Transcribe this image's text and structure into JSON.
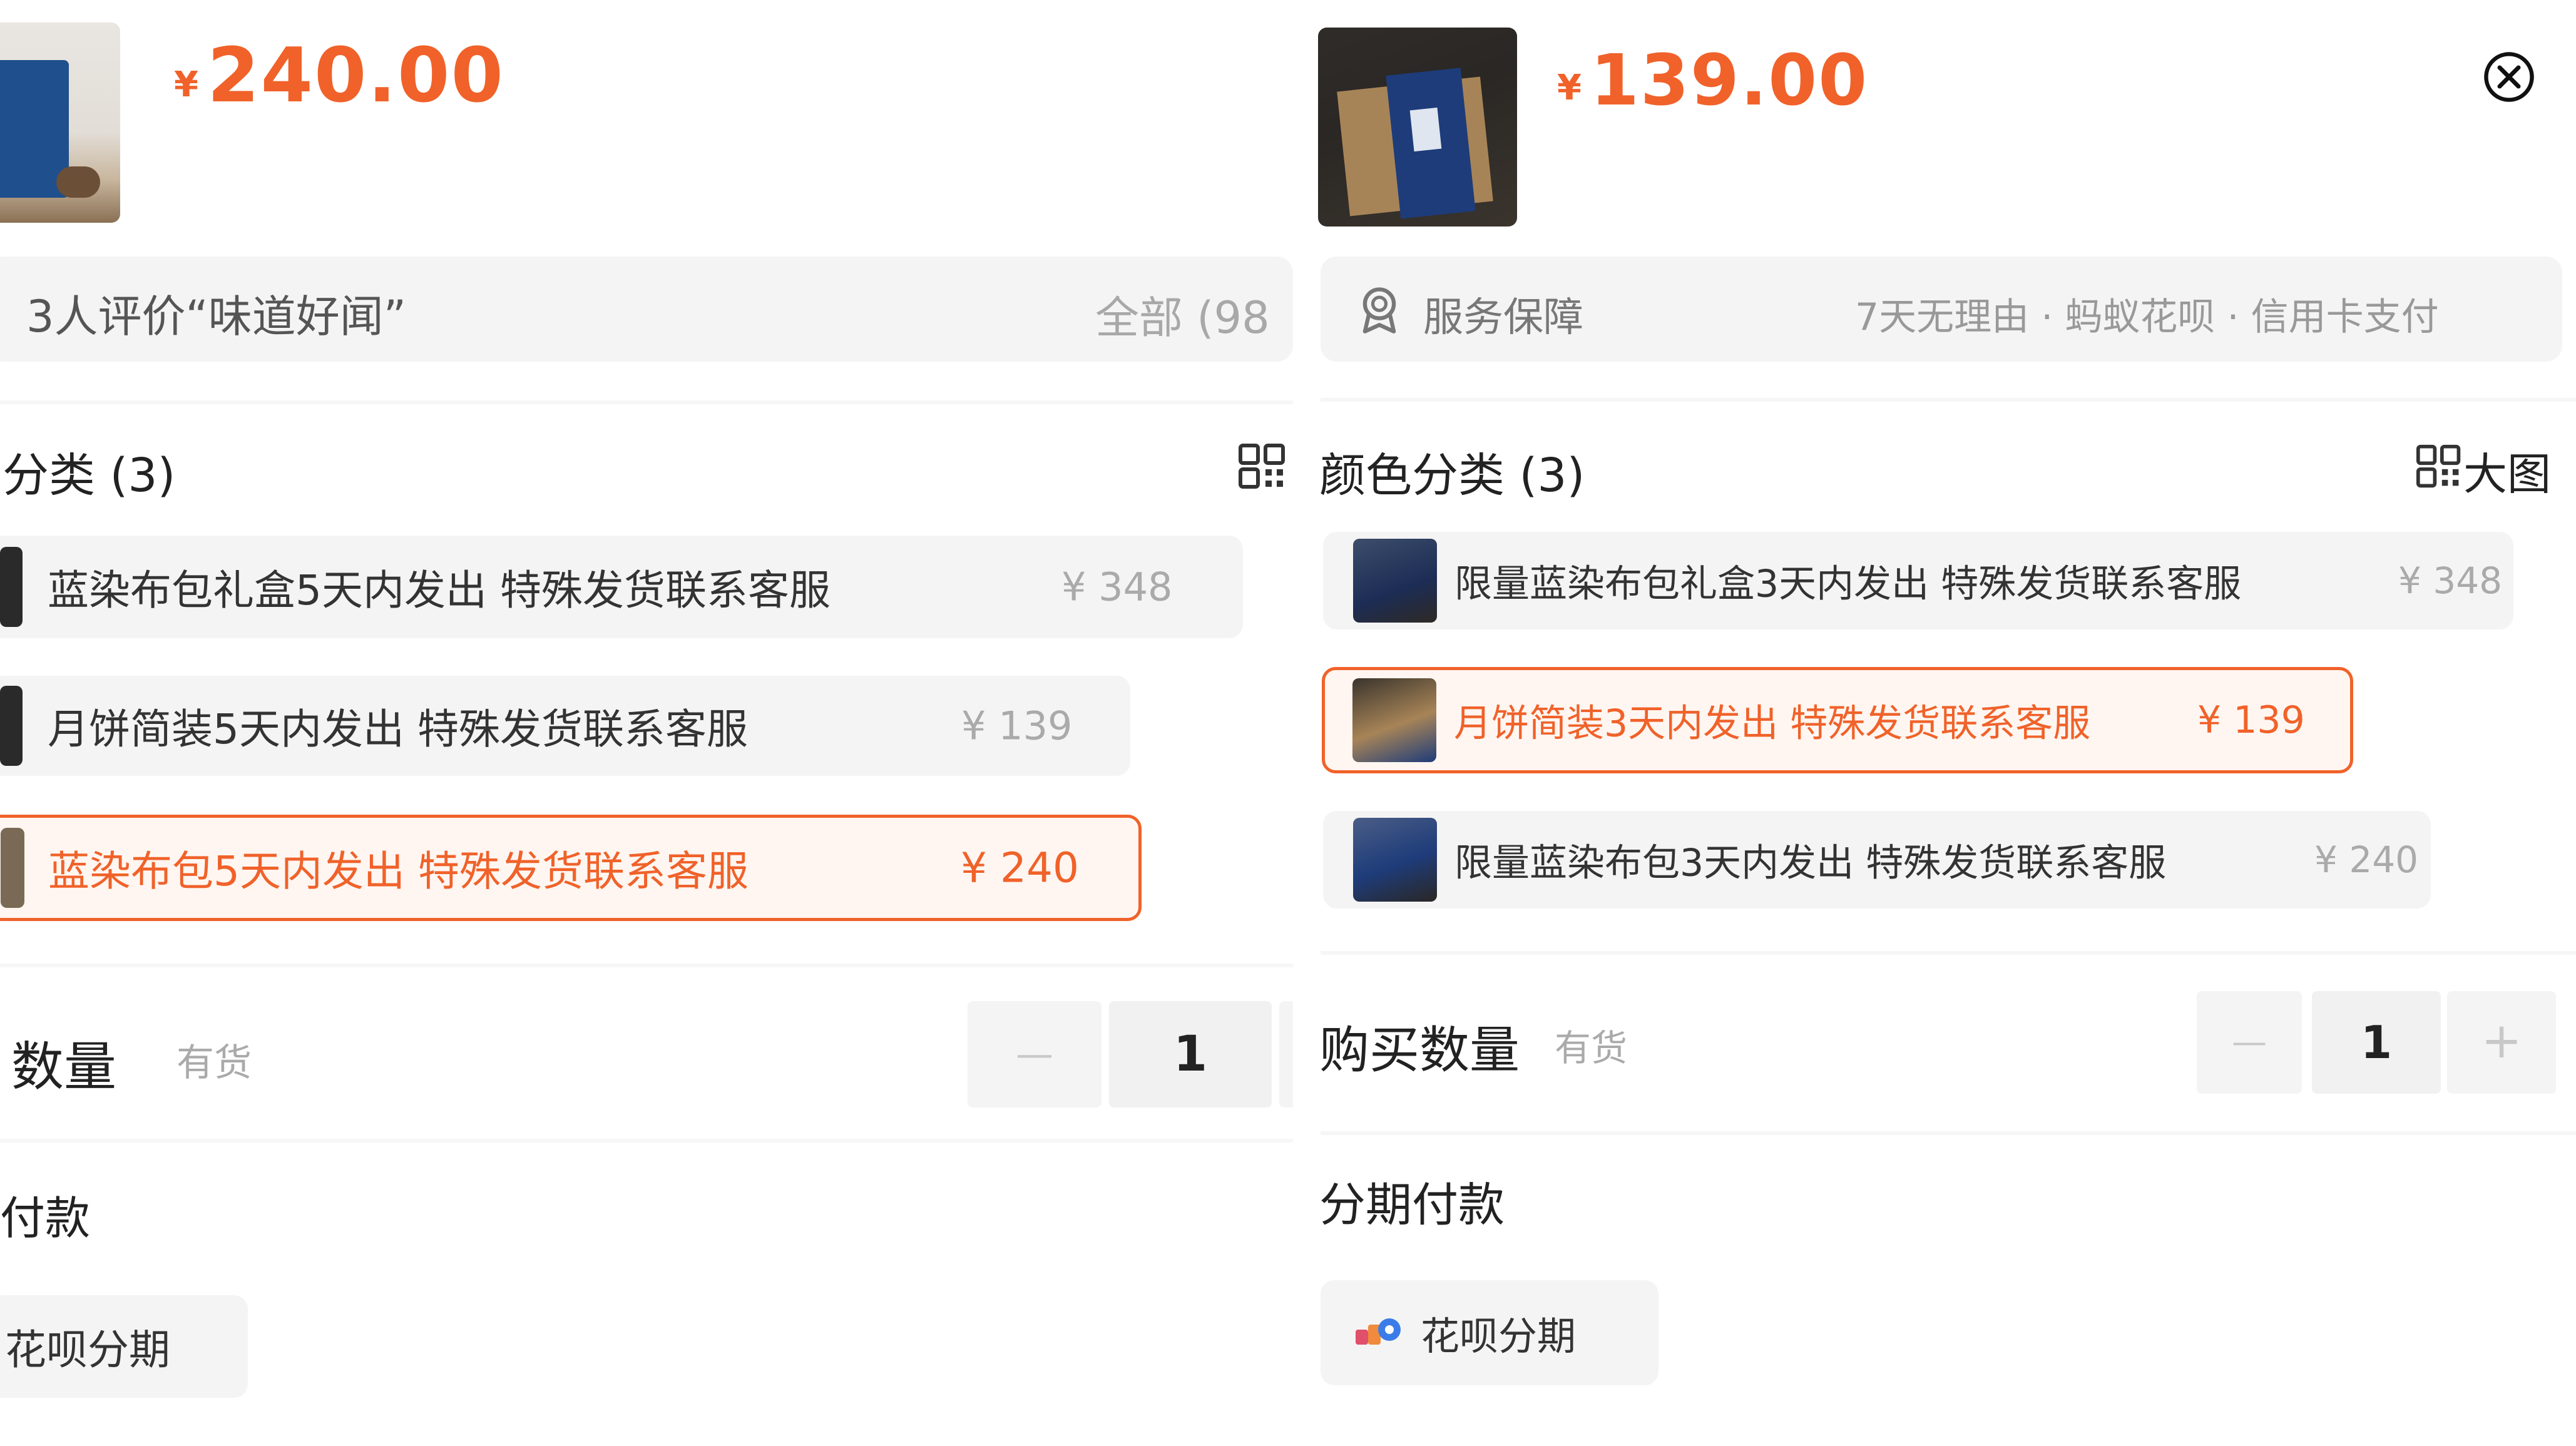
{
  "currency": "¥",
  "accent": "#f0622a",
  "left": {
    "price": "240.00",
    "review_text": "3人评价“味道好闻”",
    "review_all": "全部 (98",
    "category_title": "分类 (3)",
    "grid_icon": "grid-icon",
    "options": [
      {
        "label": "蓝染布包礼盒5天内发出 特殊发货联系客服",
        "price": "¥ 348",
        "selected": false
      },
      {
        "label": "月饼简装5天内发出 特殊发货联系客服",
        "price": "¥ 139",
        "selected": false
      },
      {
        "label": "蓝染布包5天内发出 特殊发货联系客服",
        "price": "¥ 240",
        "selected": true
      }
    ],
    "qty_title": "数量",
    "stock": "有货",
    "minus": "—",
    "qty": "1",
    "pay_title": "付款",
    "huabei": "花呗分期"
  },
  "right": {
    "price": "139.00",
    "close_icon": "close-circle-icon",
    "service_label": "服务保障",
    "service_detail": "7天无理由 · 蚂蚁花呗 · 信用卡支付",
    "category_title": "颜色分类 (3)",
    "big_image": "大图",
    "options": [
      {
        "label": "限量蓝染布包礼盒3天内发出 特殊发货联系客服",
        "price": "¥ 348",
        "selected": false
      },
      {
        "label": "月饼简装3天内发出 特殊发货联系客服",
        "price": "¥ 139",
        "selected": true
      },
      {
        "label": "限量蓝染布包3天内发出 特殊发货联系客服",
        "price": "¥ 240",
        "selected": false
      }
    ],
    "qty_title": "购买数量",
    "stock": "有货",
    "minus": "—",
    "qty": "1",
    "plus": "+",
    "pay_title": "分期付款",
    "huabei": "花呗分期"
  }
}
